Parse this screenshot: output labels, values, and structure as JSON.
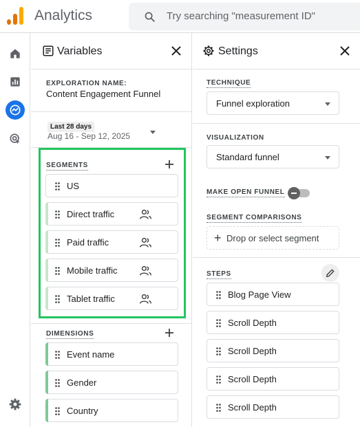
{
  "header": {
    "app_title": "Analytics",
    "search_placeholder": "Try searching \"measurement ID\""
  },
  "rail": {
    "items": [
      {
        "icon": "home-icon"
      },
      {
        "icon": "reports-icon"
      },
      {
        "icon": "explore-icon",
        "active": true
      },
      {
        "icon": "advertising-icon"
      }
    ],
    "footer_icon": "settings-gear-icon"
  },
  "variables_panel": {
    "title": "Variables",
    "exploration_name_label": "EXPLORATION NAME:",
    "exploration_name": "Content Engagement Funnel",
    "date_chip": "Last 28 days",
    "date_range": "Aug 16 - Sep 12, 2025",
    "segments_label": "SEGMENTS",
    "segments": [
      {
        "label": "US",
        "has_people_icon": false
      },
      {
        "label": "Direct traffic",
        "has_people_icon": true
      },
      {
        "label": "Paid traffic",
        "has_people_icon": true
      },
      {
        "label": "Mobile traffic",
        "has_people_icon": true
      },
      {
        "label": "Tablet traffic",
        "has_people_icon": true
      }
    ],
    "dimensions_label": "DIMENSIONS",
    "dimensions": [
      {
        "label": "Event name"
      },
      {
        "label": "Gender"
      },
      {
        "label": "Country"
      }
    ],
    "highlight_color": "#22c55e"
  },
  "settings_panel": {
    "title": "Settings",
    "technique_label": "TECHNIQUE",
    "technique_value": "Funnel exploration",
    "visualization_label": "VISUALIZATION",
    "visualization_value": "Standard funnel",
    "open_funnel_label": "MAKE OPEN FUNNEL",
    "open_funnel_on": false,
    "segment_comparisons_label": "SEGMENT COMPARISONS",
    "drop_segment_label": "Drop or select segment",
    "steps_label": "STEPS",
    "steps": [
      {
        "label": "Blog Page View"
      },
      {
        "label": "Scroll Depth"
      },
      {
        "label": "Scroll Depth"
      },
      {
        "label": "Scroll Depth"
      },
      {
        "label": "Scroll Depth"
      }
    ]
  }
}
